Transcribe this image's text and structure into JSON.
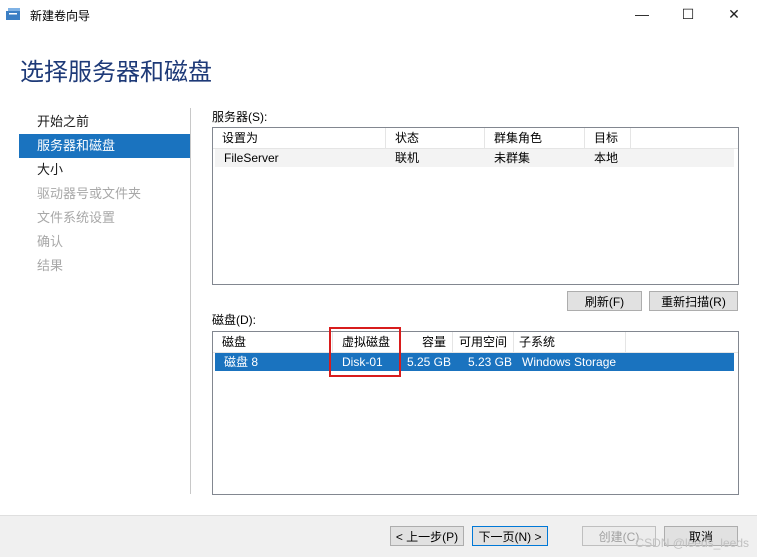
{
  "window": {
    "title": "新建卷向导",
    "minimize_glyph": "—",
    "maximize_glyph": "☐",
    "close_glyph": "✕"
  },
  "page_title": "选择服务器和磁盘",
  "nav": [
    {
      "label": "开始之前",
      "state": "normal"
    },
    {
      "label": "服务器和磁盘",
      "state": "active"
    },
    {
      "label": "大小",
      "state": "normal"
    },
    {
      "label": "驱动器号或文件夹",
      "state": "disabled"
    },
    {
      "label": "文件系统设置",
      "state": "disabled"
    },
    {
      "label": "确认",
      "state": "disabled"
    },
    {
      "label": "结果",
      "state": "disabled"
    }
  ],
  "servers": {
    "label": "服务器(S):",
    "columns": [
      "设置为",
      "状态",
      "群集角色",
      "目标"
    ],
    "rows": [
      [
        "FileServer",
        "联机",
        "未群集",
        "本地"
      ]
    ],
    "refresh_label": "刷新(F)",
    "rescan_label": "重新扫描(R)"
  },
  "disks": {
    "label": "磁盘(D):",
    "columns": [
      "磁盘",
      "虚拟磁盘",
      "容量",
      "可用空间",
      "子系统"
    ],
    "rows": [
      [
        "磁盘 8",
        "Disk-01",
        "5.25 GB",
        "5.23 GB",
        "Windows Storage"
      ]
    ]
  },
  "footer": {
    "prev_label": "< 上一步(P)",
    "next_label": "下一页(N) >",
    "create_label": "创建(C)",
    "cancel_label": "取消"
  },
  "watermark": "CSDN @leeds_leeds",
  "colors": {
    "accent": "#1a73bf",
    "title": "#1e3a78",
    "highlight": "#d81c1c"
  }
}
